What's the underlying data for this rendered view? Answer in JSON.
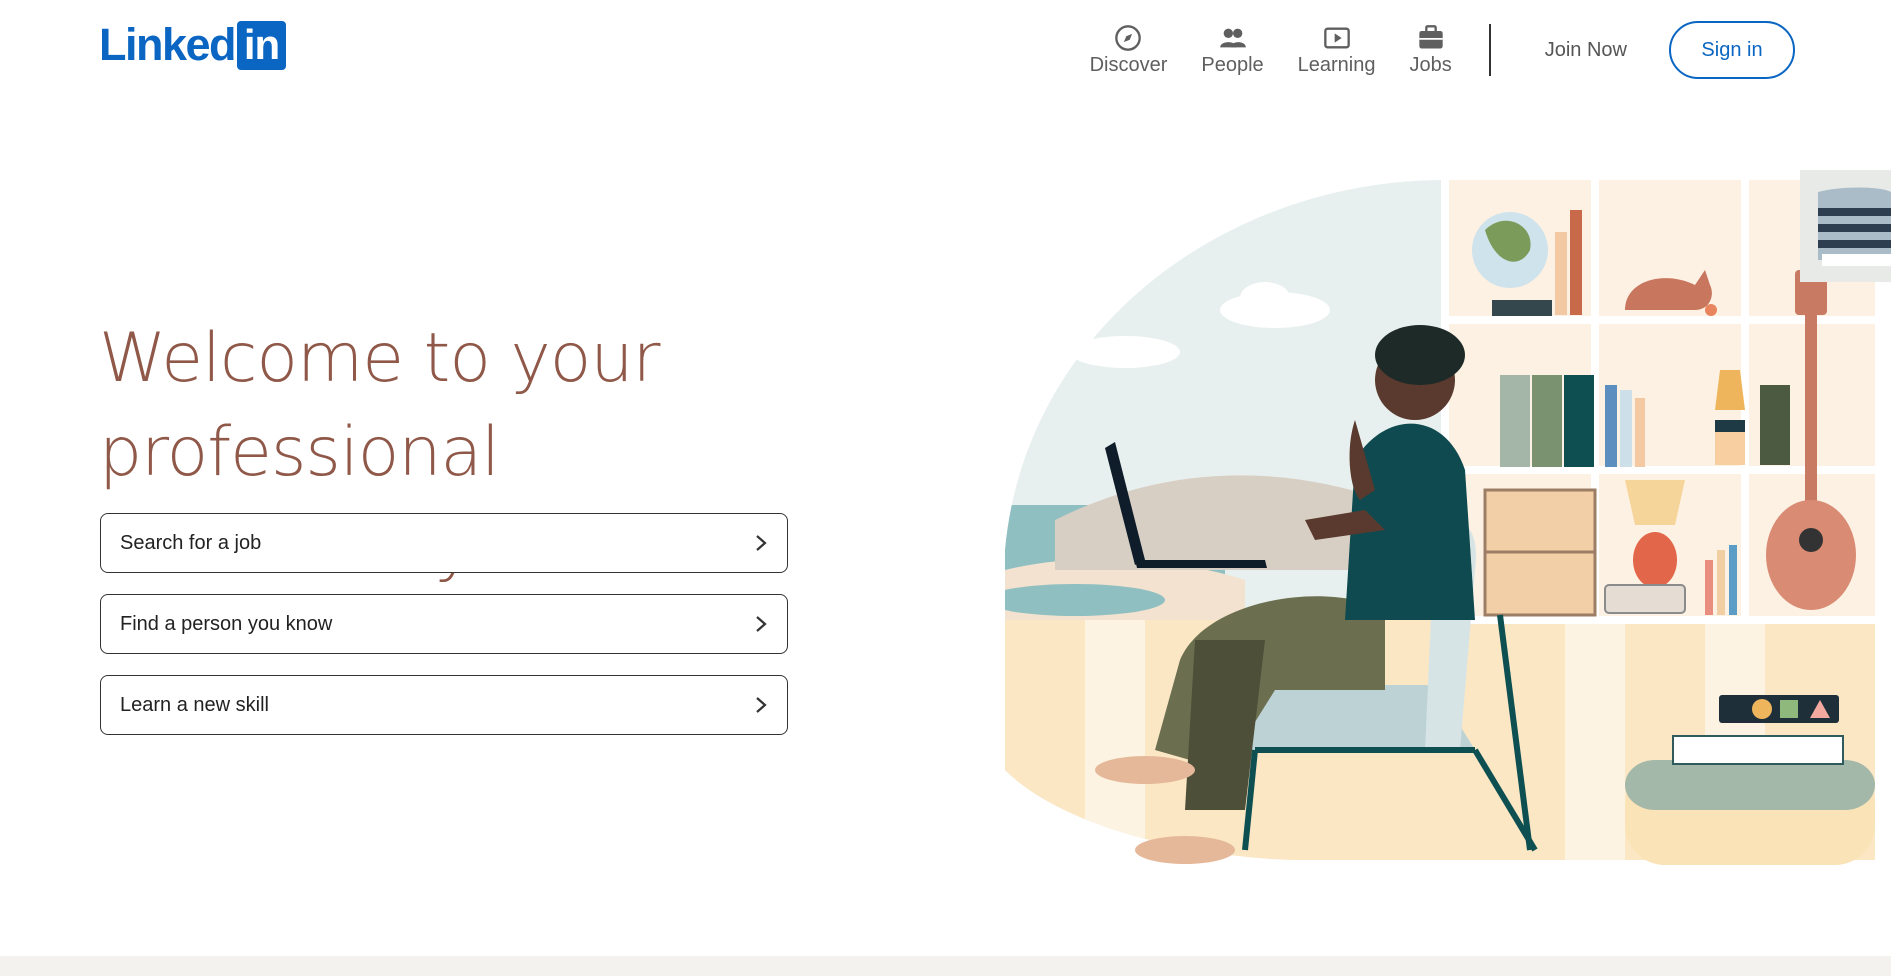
{
  "header": {
    "logo_word": "Linked",
    "logo_box": "in",
    "nav": [
      {
        "label": "Discover",
        "icon": "compass-icon"
      },
      {
        "label": "People",
        "icon": "people-icon"
      },
      {
        "label": "Learning",
        "icon": "play-icon"
      },
      {
        "label": "Jobs",
        "icon": "briefcase-icon"
      }
    ],
    "join_label": "Join Now",
    "signin_label": "Sign in"
  },
  "hero": {
    "title_line1": "Welcome to your professional",
    "title_line2": "community",
    "actions": [
      {
        "label": "Search for a job"
      },
      {
        "label": "Find a person you know"
      },
      {
        "label": "Learn a new skill"
      }
    ]
  },
  "colors": {
    "brand": "#0a66c2",
    "title": "#8f5849",
    "nav_text": "#5f5f5f"
  }
}
